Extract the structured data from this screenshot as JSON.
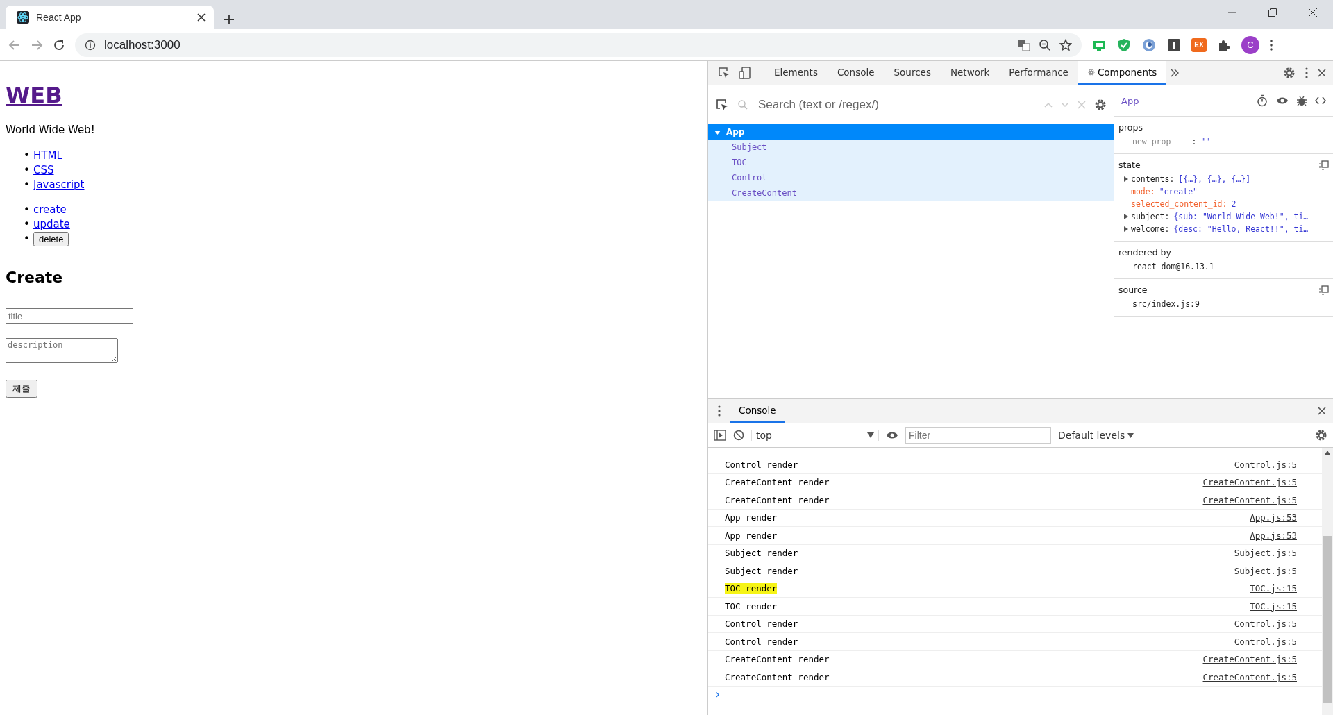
{
  "browser": {
    "tab_title": "React App",
    "address": "localhost:3000",
    "extensions": [
      {
        "kind": "monitor"
      },
      {
        "kind": "shield"
      },
      {
        "kind": "orb"
      },
      {
        "kind": "dark"
      },
      {
        "kind": "badge",
        "label": "EX"
      },
      {
        "kind": "puzzle"
      }
    ],
    "profile": "C"
  },
  "page": {
    "bullet": "•",
    "heading": "WEB",
    "subtitle": "World Wide Web!",
    "toc": [
      "HTML",
      "CSS",
      "Javascript"
    ],
    "controls": [
      {
        "kind": "link",
        "label": "create"
      },
      {
        "kind": "link",
        "label": "update"
      },
      {
        "kind": "button",
        "label": "delete"
      }
    ],
    "form": {
      "heading": "Create",
      "title_placeholder": "title",
      "description_placeholder": "description",
      "submit": "제출"
    }
  },
  "devtools": {
    "tabs": [
      {
        "label": "Elements",
        "selected": false
      },
      {
        "label": "Console",
        "selected": false
      },
      {
        "label": "Sources",
        "selected": false
      },
      {
        "label": "Network",
        "selected": false
      },
      {
        "label": "Performance",
        "selected": false
      },
      {
        "label": "Components",
        "selected": true
      }
    ],
    "components": {
      "search_placeholder": "Search (text or /regex/)",
      "tree": [
        {
          "label": "App",
          "selected": true,
          "expanded": true,
          "children": [
            {
              "label": "Subject"
            },
            {
              "label": "TOC"
            },
            {
              "label": "Control"
            },
            {
              "label": "CreateContent"
            }
          ]
        }
      ],
      "inspected": "App",
      "props": {
        "title": "props",
        "rows": [
          {
            "key": "new prop",
            "separator": ":",
            "value": "\"\""
          }
        ]
      },
      "state": {
        "title": "state",
        "rows": [
          {
            "kind": "object",
            "key": "contents:",
            "value": "[{…}, {…}, {…}]"
          },
          {
            "kind": "primitive",
            "key": "mode:",
            "value": "\"create\""
          },
          {
            "kind": "primitive",
            "key": "selected_content_id:",
            "value": "2"
          },
          {
            "kind": "object",
            "key": "subject:",
            "value": "{sub: \"World Wide Web!\", ti…"
          },
          {
            "kind": "object",
            "key": "welcome:",
            "value": "{desc: \"Hello, React!!\", ti…"
          }
        ]
      },
      "rendered_by": {
        "title": "rendered by",
        "value": "react-dom@16.13.1"
      },
      "source": {
        "title": "source",
        "value": "src/index.js:9"
      }
    },
    "console": {
      "tab": "Console",
      "context": "top",
      "filter_placeholder": "Filter",
      "levels": "Default levels",
      "messages": [
        {
          "text": "Control render",
          "source": "Control.js:5",
          "highlighted": false
        },
        {
          "text": "CreateContent render",
          "source": "CreateContent.js:5",
          "highlighted": false
        },
        {
          "text": "CreateContent render",
          "source": "CreateContent.js:5",
          "highlighted": false
        },
        {
          "text": "App render",
          "source": "App.js:53",
          "highlighted": false
        },
        {
          "text": "App render",
          "source": "App.js:53",
          "highlighted": false
        },
        {
          "text": "Subject render",
          "source": "Subject.js:5",
          "highlighted": false
        },
        {
          "text": "Subject render",
          "source": "Subject.js:5",
          "highlighted": false
        },
        {
          "text": "TOC render",
          "source": "TOC.js:15",
          "highlighted": true
        },
        {
          "text": "TOC render",
          "source": "TOC.js:15",
          "highlighted": false
        },
        {
          "text": "Control render",
          "source": "Control.js:5",
          "highlighted": false
        },
        {
          "text": "Control render",
          "source": "Control.js:5",
          "highlighted": false
        },
        {
          "text": "CreateContent render",
          "source": "CreateContent.js:5",
          "highlighted": false
        },
        {
          "text": "CreateContent render",
          "source": "CreateContent.js:5",
          "highlighted": false
        }
      ],
      "prompt": "›"
    }
  }
}
